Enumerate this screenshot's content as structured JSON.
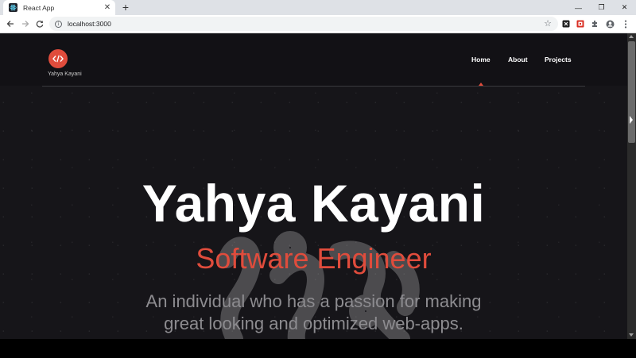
{
  "browser": {
    "tab_title": "React App",
    "tab_close": "✕",
    "new_tab": "+",
    "url": "localhost:3000",
    "window_controls": {
      "minimize": "—",
      "restore": "❐",
      "close": "✕"
    }
  },
  "navbar": {
    "logo_icon": "code-brackets-icon",
    "logo_text": "Yahya Kayani",
    "links": [
      {
        "label": "Home",
        "active": true
      },
      {
        "label": "About",
        "active": false
      },
      {
        "label": "Projects",
        "active": false
      }
    ]
  },
  "hero": {
    "name": "Yahya Kayani",
    "role": "Software Engineer",
    "tagline_line1": "An individual who has a passion for making",
    "tagline_line2": "great looking and optimized web-apps."
  },
  "colors": {
    "accent": "#e04c3c",
    "background": "#161519",
    "navbar": "#121115",
    "text": "#ffffff",
    "muted": "#8d8c90"
  }
}
